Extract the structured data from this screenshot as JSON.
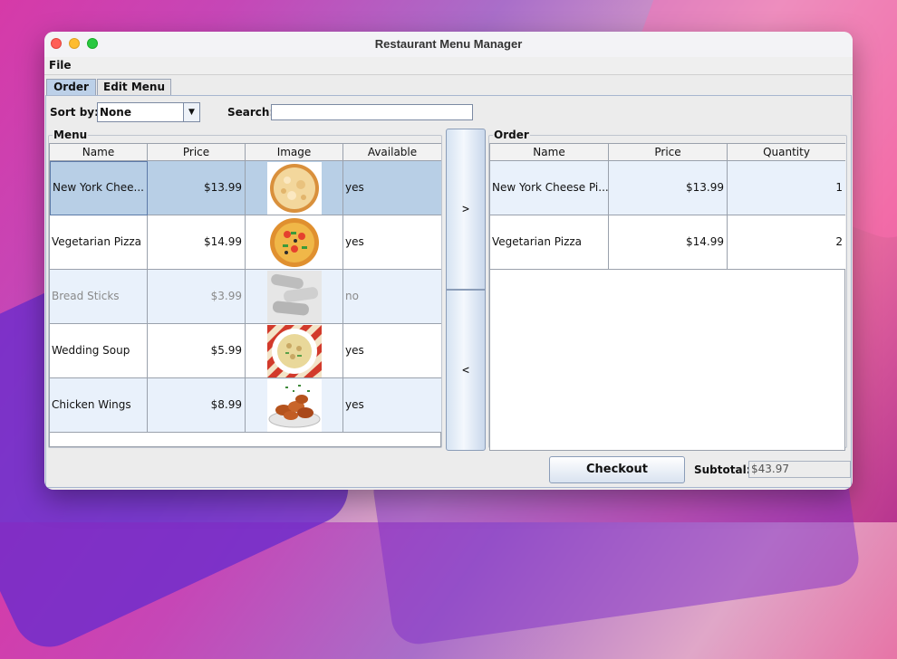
{
  "window": {
    "title": "Restaurant Menu Manager"
  },
  "menubar": {
    "file": "File"
  },
  "tabs": [
    "Order",
    "Edit Menu"
  ],
  "controls": {
    "sort_label": "Sort by:",
    "sort_value": "None",
    "search_label": "Search:",
    "search_value": "",
    "move_right": ">",
    "move_left": "<"
  },
  "menu": {
    "title": "Menu",
    "columns": [
      "Name",
      "Price",
      "Image",
      "Available"
    ],
    "rows": [
      {
        "name": "New York Chee...",
        "price": "$13.99",
        "image": "cheese-pizza",
        "available": "yes"
      },
      {
        "name": "Vegetarian Pizza",
        "price": "$14.99",
        "image": "vegetarian-pizza",
        "available": "yes"
      },
      {
        "name": "Bread Sticks",
        "price": "$3.99",
        "image": "bread-sticks",
        "available": "no"
      },
      {
        "name": "Wedding Soup",
        "price": "$5.99",
        "image": "wedding-soup",
        "available": "yes"
      },
      {
        "name": "Chicken Wings",
        "price": "$8.99",
        "image": "chicken-wings",
        "available": "yes"
      }
    ]
  },
  "order": {
    "title": "Order",
    "columns": [
      "Name",
      "Price",
      "Quantity"
    ],
    "rows": [
      {
        "name": "New York Cheese Pi...",
        "price": "$13.99",
        "quantity": "1"
      },
      {
        "name": "Vegetarian Pizza",
        "price": "$14.99",
        "quantity": "2"
      }
    ]
  },
  "footer": {
    "checkout_label": "Checkout",
    "subtotal_label": "Subtotal:",
    "subtotal_value": "$43.97"
  },
  "colors": {
    "selected_row": "#b8cfe6",
    "alt_row": "#e9f1fb",
    "normal_row": "#ffffff"
  }
}
